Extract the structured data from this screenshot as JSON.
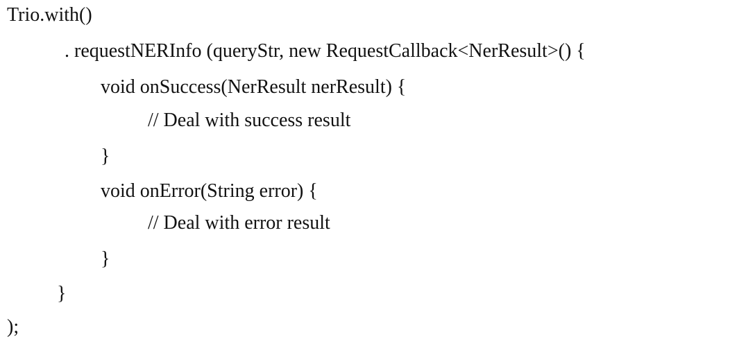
{
  "code": {
    "lines": [
      "Trio.with()",
      ". requestNERInfo (queryStr, new RequestCallback<NerResult>() {",
      "void onSuccess(NerResult nerResult) {",
      "// Deal with success result",
      "}",
      "void onError(String error) {",
      "// Deal with error result",
      "}",
      "}",
      ");"
    ]
  }
}
